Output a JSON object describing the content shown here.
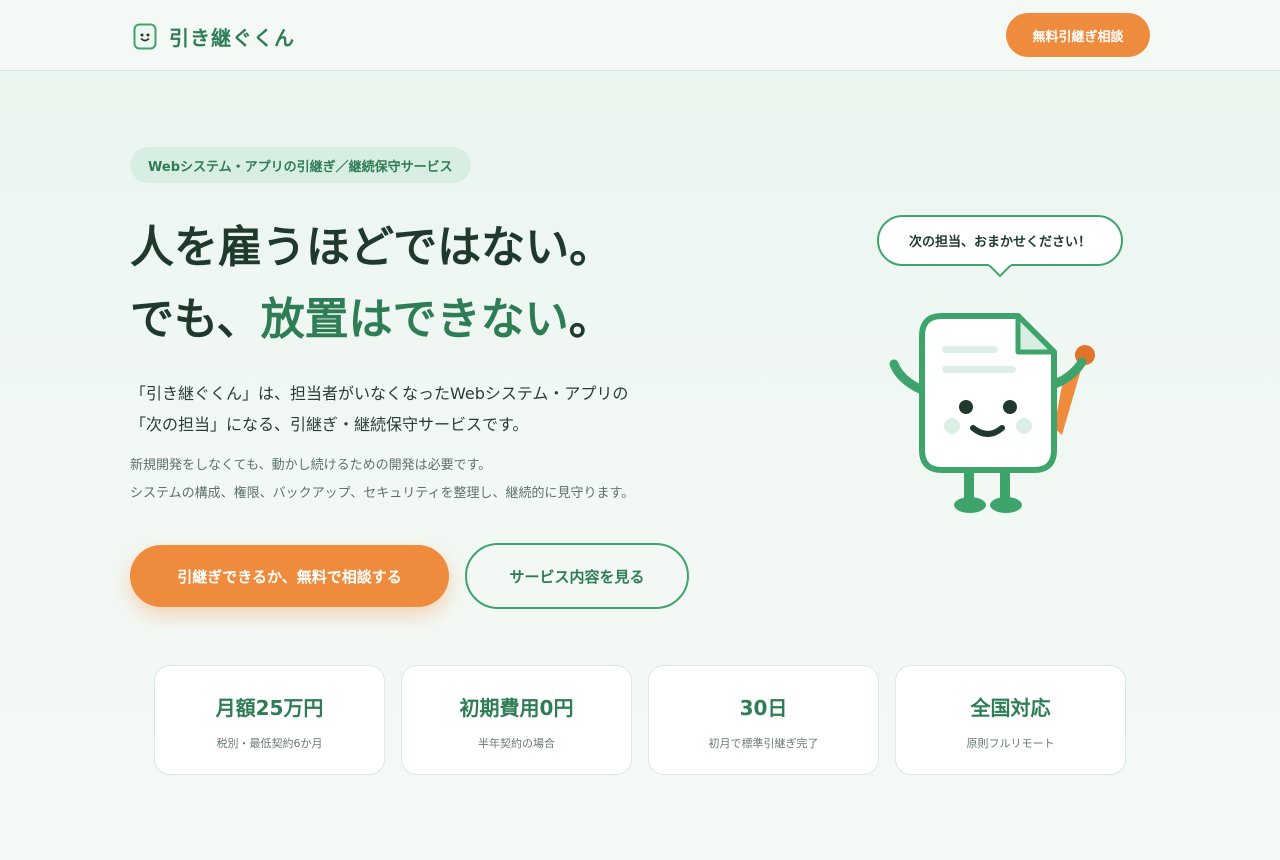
{
  "header": {
    "brand": "引き継ぐくん",
    "cta_label": "無料引継ぎ相談"
  },
  "hero": {
    "badge": "Webシステム・アプリの引継ぎ／継続保守サービス",
    "headline_line1": "人を雇うほどではない。",
    "headline_line2_prefix": "でも、",
    "headline_line2_accent": "放置はできない",
    "headline_line2_suffix": "。",
    "lead_line1": "「引き継ぐくん」は、担当者がいなくなったWebシステム・アプリの",
    "lead_line2": "「次の担当」になる、引継ぎ・継続保守サービスです。",
    "sub_line1": "新規開発をしなくても、動かし続けるための開発は必要です。",
    "sub_line2": "システムの構成、権限、バックアップ、セキュリティを整理し、継続的に見守ります。",
    "primary_button": "引継ぎできるか、無料で相談する",
    "secondary_button": "サービス内容を見る"
  },
  "mascot": {
    "speech": "次の担当、おまかせください！",
    "icon": "document-mascot"
  },
  "stats": [
    {
      "value": "月額25万円",
      "note": "税別・最低契約6か月"
    },
    {
      "value": "初期費用0円",
      "note": "半年契約の場合"
    },
    {
      "value": "30日",
      "note": "初月で標準引継ぎ完了"
    },
    {
      "value": "全国対応",
      "note": "原則フルリモート"
    }
  ],
  "colors": {
    "brand_green": "#2e7d55",
    "accent_orange": "#ef8b3c",
    "mascot_green": "#3ea46c"
  }
}
